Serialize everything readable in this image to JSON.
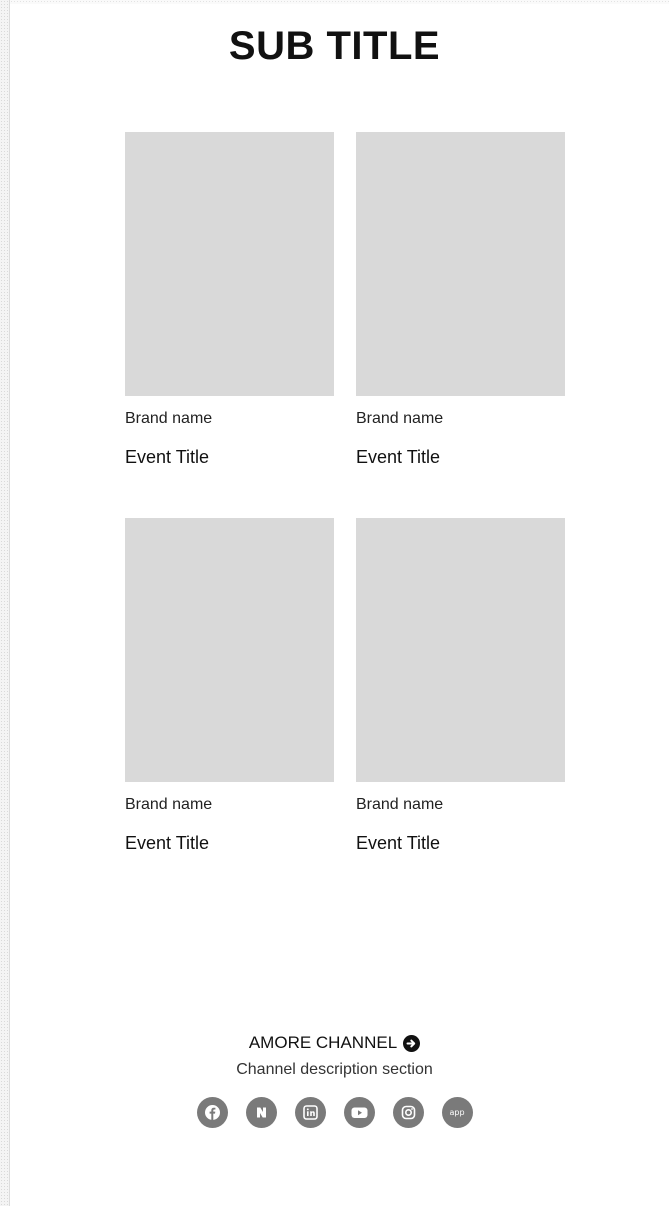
{
  "header": {
    "sub_title": "SUB TITLE"
  },
  "cards": [
    {
      "brand": "Brand name",
      "title": "Event Title"
    },
    {
      "brand": "Brand name",
      "title": "Event Title"
    },
    {
      "brand": "Brand name",
      "title": "Event Title"
    },
    {
      "brand": "Brand name",
      "title": "Event Title"
    }
  ],
  "channel": {
    "label": "AMORE CHANNEL",
    "description": "Channel description section",
    "icons": [
      "facebook-icon",
      "naver-icon",
      "linkedin-icon",
      "youtube-icon",
      "instagram-icon",
      "app-icon"
    ],
    "app_label": "app"
  },
  "colors": {
    "placeholder": "#d9d9d9",
    "social": "#7a7a7a"
  }
}
